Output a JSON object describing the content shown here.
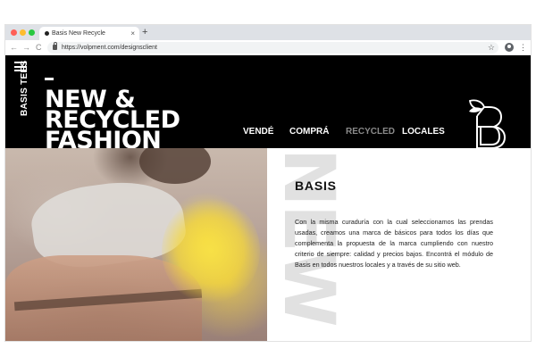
{
  "browser": {
    "tab_title": "Basis New Recycle",
    "tab_close": "×",
    "new_tab": "+",
    "url": "https://volpment.com/designsclient",
    "back": "←",
    "forward": "→",
    "reload": "C",
    "star": "☆",
    "menu": "⋮"
  },
  "site": {
    "brand_vertical": "BASIS TEES",
    "hero_lines": [
      "NEW &",
      "RECYCLED",
      "FASHION"
    ],
    "nav": [
      {
        "label": "VENDÉ",
        "active": false
      },
      {
        "label": "COMPRÁ",
        "active": false
      },
      {
        "label": "RECYCLED",
        "active": true
      },
      {
        "label": "LOCALES",
        "active": false
      }
    ],
    "logo_icon": "basis-b-leaf-logo"
  },
  "content": {
    "watermark": "NEW",
    "section_title": "BASIS",
    "section_body": "Con la misma curaduría con la cual seleccionamos las prendas usadas, creamos una marca de básicos para todos los días que complementa la propuesta de la marca cumpliendo con nuestro criterio de siempre: calidad y precios bajos. Encontrá el módulo de Basis en todos nuestros locales y a través de su sitio web."
  },
  "colors": {
    "header_bg": "#000000",
    "nav_active": "#8a8a8a",
    "accent_yellow": "#f3dc46"
  }
}
